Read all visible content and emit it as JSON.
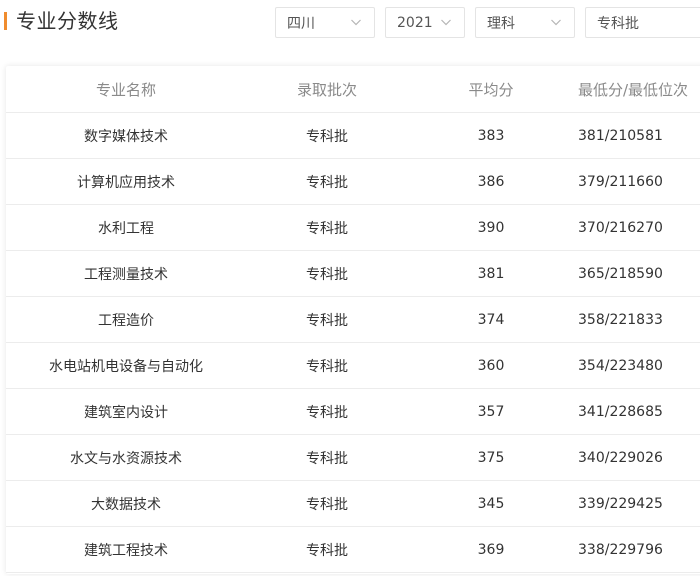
{
  "header": {
    "title": "专业分数线"
  },
  "filters": {
    "province": "四川",
    "year": "2021",
    "subject": "理科",
    "batch": "专科批"
  },
  "table": {
    "columns": [
      "专业名称",
      "录取批次",
      "平均分",
      "最低分/最低位次"
    ],
    "rows": [
      [
        "数字媒体技术",
        "专科批",
        "383",
        "381/210581"
      ],
      [
        "计算机应用技术",
        "专科批",
        "386",
        "379/211660"
      ],
      [
        "水利工程",
        "专科批",
        "390",
        "370/216270"
      ],
      [
        "工程测量技术",
        "专科批",
        "381",
        "365/218590"
      ],
      [
        "工程造价",
        "专科批",
        "374",
        "358/221833"
      ],
      [
        "水电站机电设备与自动化",
        "专科批",
        "360",
        "354/223480"
      ],
      [
        "建筑室内设计",
        "专科批",
        "357",
        "341/228685"
      ],
      [
        "水文与水资源技术",
        "专科批",
        "375",
        "340/229026"
      ],
      [
        "大数据技术",
        "专科批",
        "345",
        "339/229425"
      ],
      [
        "建筑工程技术",
        "专科批",
        "369",
        "338/229796"
      ]
    ]
  },
  "colors": {
    "accent": "#f08c2e",
    "header_text": "#8a8a8a",
    "border": "#ececec"
  }
}
